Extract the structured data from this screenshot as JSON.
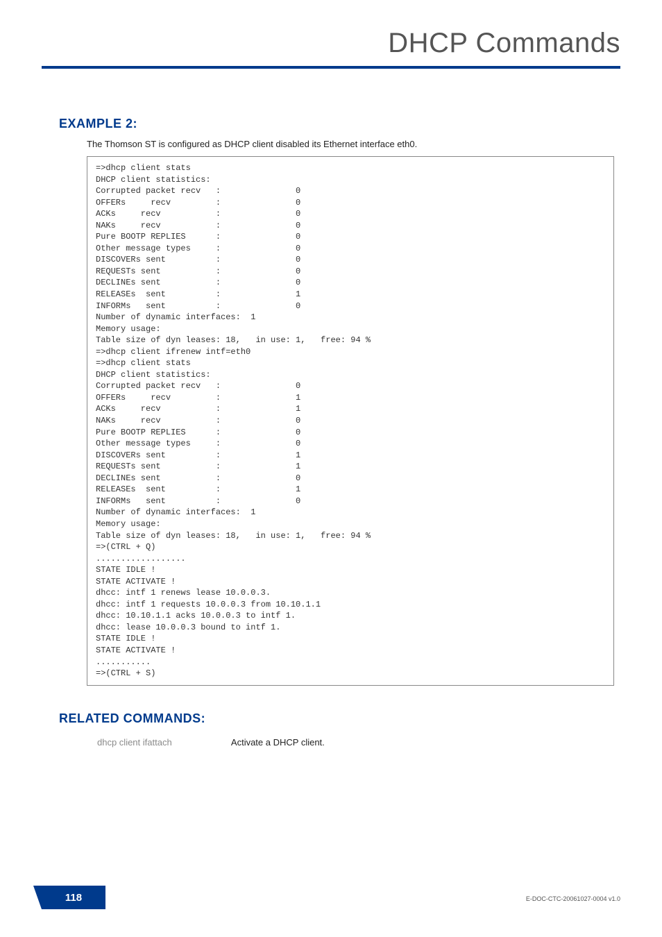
{
  "header": {
    "title": "DHCP Commands"
  },
  "example": {
    "heading": "EXAMPLE 2:",
    "subtitle": "The Thomson ST is configured as DHCP client disabled its Ethernet interface eth0.",
    "code": "=>dhcp client stats\nDHCP client statistics:\nCorrupted packet recv   :               0\nOFFERs     recv         :               0\nACKs     recv           :               0\nNAKs     recv           :               0\nPure BOOTP REPLIES      :               0\nOther message types     :               0\nDISCOVERs sent          :               0\nREQUESTs sent           :               0\nDECLINEs sent           :               0\nRELEASEs  sent          :               1\nINFORMs   sent          :               0\nNumber of dynamic interfaces:  1\nMemory usage:\nTable size of dyn leases: 18,   in use: 1,   free: 94 %\n=>dhcp client ifrenew intf=eth0\n=>dhcp client stats\nDHCP client statistics:\nCorrupted packet recv   :               0\nOFFERs     recv         :               1\nACKs     recv           :               1\nNAKs     recv           :               0\nPure BOOTP REPLIES      :               0\nOther message types     :               0\nDISCOVERs sent          :               1\nREQUESTs sent           :               1\nDECLINEs sent           :               0\nRELEASEs  sent          :               1\nINFORMs   sent          :               0\nNumber of dynamic interfaces:  1\nMemory usage:\nTable size of dyn leases: 18,   in use: 1,   free: 94 %\n=>(CTRL + Q)\n..................\nSTATE IDLE !\nSTATE ACTIVATE !\ndhcc: intf 1 renews lease 10.0.0.3.\ndhcc: intf 1 requests 10.0.0.3 from 10.10.1.1\ndhcc: 10.10.1.1 acks 10.0.0.3 to intf 1.\ndhcc: lease 10.0.0.3 bound to intf 1.\nSTATE IDLE !\nSTATE ACTIVATE !\n...........\n=>(CTRL + S)"
  },
  "related": {
    "heading": "RELATED COMMANDS:",
    "cmd": "dhcp client ifattach",
    "desc": "Activate a DHCP client."
  },
  "footer": {
    "page": "118",
    "docid": "E-DOC-CTC-20061027-0004 v1.0"
  }
}
